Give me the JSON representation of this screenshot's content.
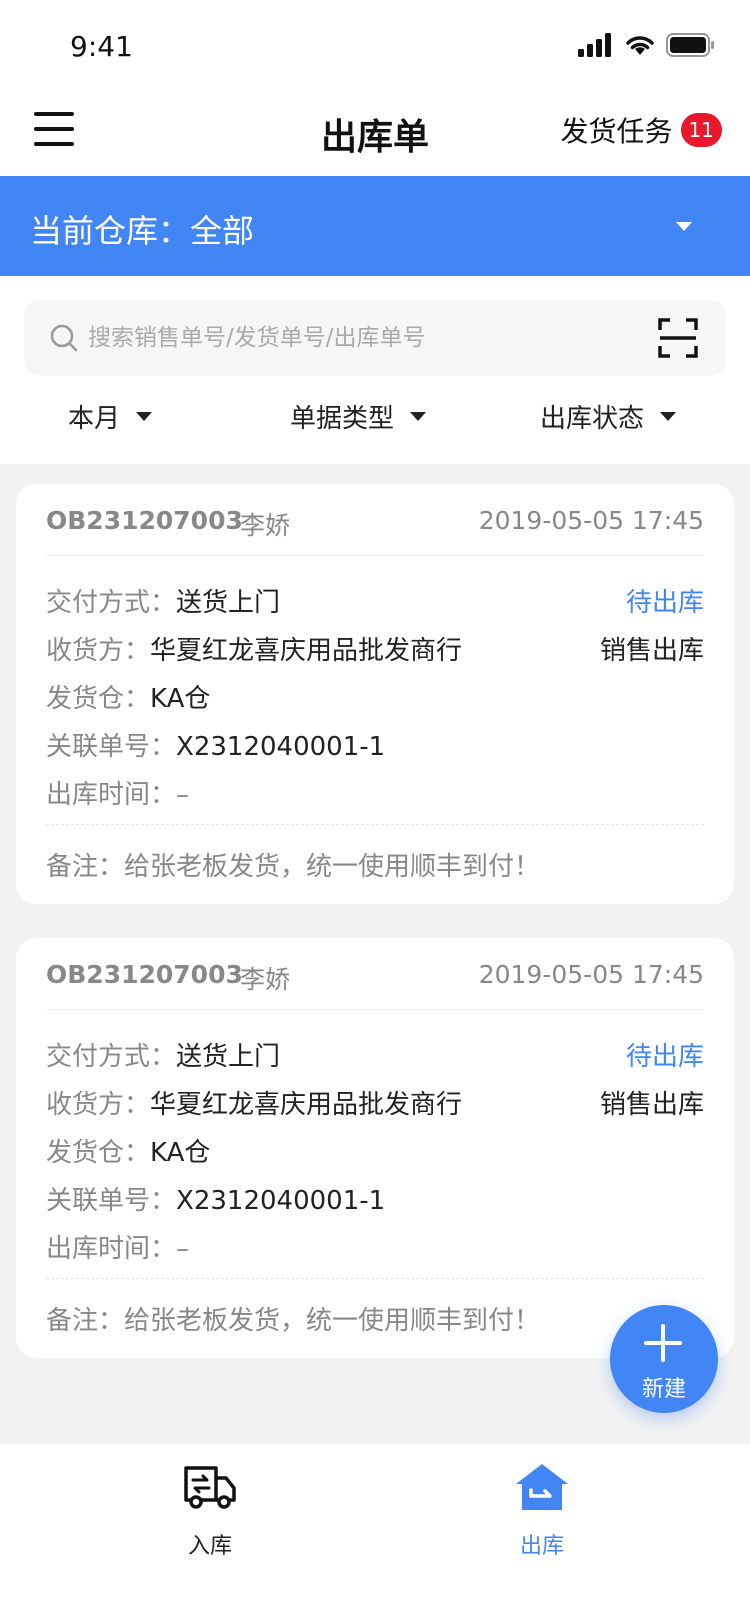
{
  "status_bar": {
    "time": "9:41"
  },
  "header": {
    "title": "出库单",
    "task_label": "发货任务",
    "task_badge": "11"
  },
  "warehouse": {
    "label": "当前仓库：全部"
  },
  "search": {
    "placeholder": "搜索销售单号/发货单号/出库单号"
  },
  "filters": [
    {
      "label": "本月"
    },
    {
      "label": "单据类型"
    },
    {
      "label": "出库状态"
    }
  ],
  "orders": [
    {
      "id": "OB231207003",
      "person": "李娇",
      "time": "2019-05-05 17:45",
      "delivery_label": "交付方式：",
      "delivery_value": "送货上门",
      "status": "待出库",
      "receiver_label": "收货方：",
      "receiver_value": "华夏红龙喜庆用品批发商行",
      "order_type": "销售出库",
      "warehouse_label": "发货仓：",
      "warehouse_value": "KA仓",
      "related_label": "关联单号：",
      "related_value": "X2312040001-1",
      "out_time_label": "出库时间：",
      "out_time_value": "–",
      "note": "备注：给张老板发货，统一使用顺丰到付！"
    },
    {
      "id": "OB231207003",
      "person": "李娇",
      "time": "2019-05-05 17:45",
      "delivery_label": "交付方式：",
      "delivery_value": "送货上门",
      "status": "待出库",
      "receiver_label": "收货方：",
      "receiver_value": "华夏红龙喜庆用品批发商行",
      "order_type": "销售出库",
      "warehouse_label": "发货仓：",
      "warehouse_value": "KA仓",
      "related_label": "关联单号：",
      "related_value": "X2312040001-1",
      "out_time_label": "出库时间：",
      "out_time_value": "–",
      "note": "备注：给张老板发货，统一使用顺丰到付！"
    }
  ],
  "fab": {
    "label": "新建"
  },
  "tabs": [
    {
      "label": "入库",
      "icon": "truck-icon"
    },
    {
      "label": "出库",
      "icon": "warehouse-out-icon"
    }
  ],
  "colors": {
    "accent": "#4285f4",
    "badge": "#e8192c",
    "background": "#f2f2f2"
  }
}
